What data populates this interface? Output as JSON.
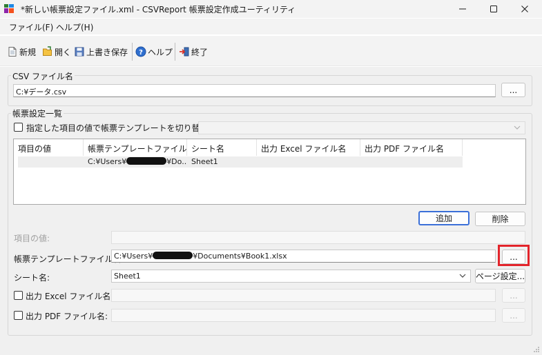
{
  "window": {
    "title": "*新しい帳票設定ファイル.xml - CSVReport 帳票設定作成ユーティリティ",
    "icons": [
      "app-icon",
      "minimize-icon",
      "maximize-icon",
      "close-icon"
    ]
  },
  "menu": [
    {
      "label": "ファイル(F)"
    },
    {
      "label": "ヘルプ(H)"
    }
  ],
  "toolbar": {
    "new": "新規",
    "open": "開く",
    "save": "上書き保存",
    "help": "ヘルプ",
    "exit": "終了"
  },
  "csv": {
    "group_label": "CSV ファイル名",
    "path": "C:¥データ.csv",
    "browse": "..."
  },
  "report": {
    "group_label": "帳票設定一覧",
    "switch_label": "指定した項目の値で帳票テンプレートを切り替える:",
    "switch_value": "",
    "columns": [
      "項目の値",
      "帳票テンプレートファイル名",
      "シート名",
      "出力 Excel ファイル名",
      "出力 PDF ファイル名"
    ],
    "rows": [
      {
        "value": "",
        "template_prefix": "C:¥Users¥",
        "template_suffix": "¥Do...",
        "sheet": "Sheet1",
        "excel": "",
        "pdf": ""
      }
    ],
    "add": "追加",
    "delete": "削除",
    "item_value_label": "項目の値:",
    "item_value": "",
    "template_label": "帳票テンプレートファイル名:",
    "template_prefix": "C:¥Users¥",
    "template_suffix": "¥Documents¥Book1.xlsx",
    "template_browse": "...",
    "sheet_label": "シート名:",
    "sheet_value": "Sheet1",
    "page_setup": "ページ設定...",
    "excel_label": "出力 Excel ファイル名:",
    "excel_value": "",
    "excel_browse": "...",
    "pdf_label": "出力 PDF ファイル名:",
    "pdf_value": "",
    "pdf_browse": "..."
  },
  "colors": {
    "highlight": "#e3242b",
    "primary_border": "#3a6fd8"
  }
}
